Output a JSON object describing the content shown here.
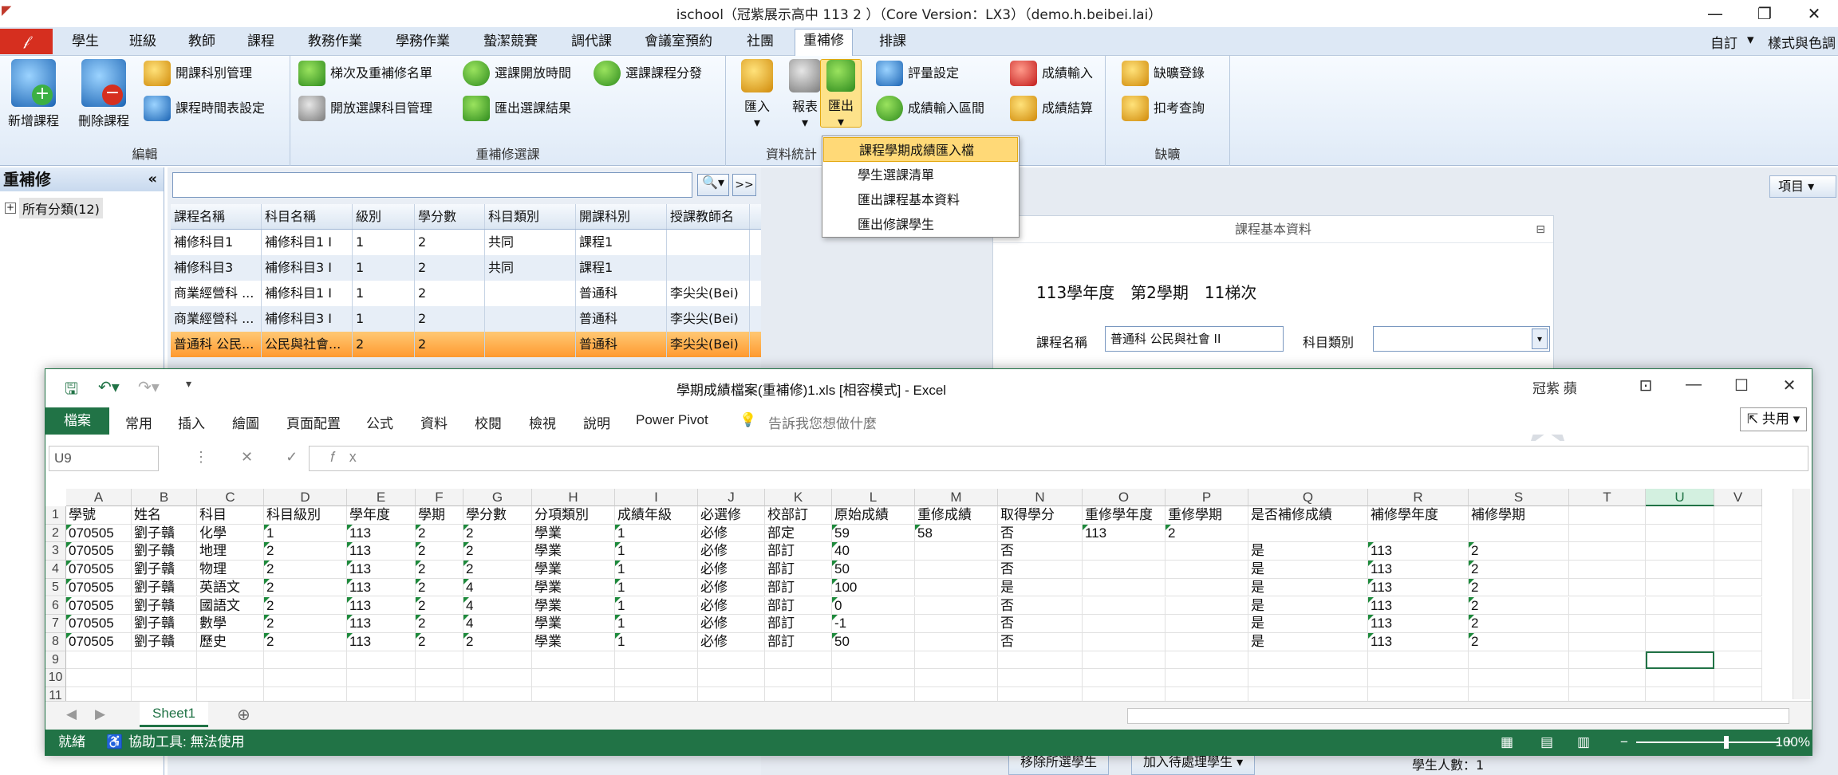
{
  "ischool": {
    "title": "ischool（冠紫展示高中 113 2 ）（Core Version：LX3）（demo.h.beibei.lai）",
    "win_controls": [
      "—",
      "❐",
      "✕"
    ],
    "tabs": [
      "學生",
      "班級",
      "教師",
      "課程",
      "教務作業",
      "學務作業",
      "蟄潔競賽",
      "調代課",
      "會議室預約",
      "社團",
      "重補修",
      "排課"
    ],
    "active_tab": "重補修",
    "right_tabs": [
      "自訂",
      "▾",
      "樣式與色調"
    ],
    "ribbon": {
      "groups": [
        "編輯",
        "重補修選課",
        "資料統計",
        "缺曠"
      ],
      "edit": {
        "add": "新增課程",
        "delete": "刪除課程",
        "subject_mgmt": "開課科別管理",
        "schedule": "課程時間表設定"
      },
      "selection": {
        "batch": "梯次及重補修名單",
        "open_time": "選課開放時間",
        "course_split": "選課課程分發",
        "open_subject": "開放選課科目管理",
        "export_result": "匯出選課結果"
      },
      "stats": {
        "import": "匯入",
        "report": "報表",
        "export": "匯出",
        "eval_setting": "評量設定",
        "score_range": "成績輸入區間",
        "score_input": "成績輸入",
        "score_calc": "成績結算"
      },
      "absence": {
        "register": "缺曠登錄",
        "deduct": "扣考查詢"
      }
    },
    "export_menu": [
      "課程學期成績匯入檔",
      "學生選課清單",
      "匯出課程基本資料",
      "匯出修課學生"
    ],
    "left_pane": {
      "title": "重補修",
      "collapse": "«",
      "tree_item": "所有分類(12)"
    },
    "search": {
      "btn": "🔍▾",
      "next": ">>"
    },
    "grid": {
      "headers": [
        "課程名稱",
        "科目名稱",
        "級別",
        "學分數",
        "科目類別",
        "開課科別",
        "授課教師名"
      ],
      "rows": [
        [
          "補修科目1",
          "補修科目1 I",
          "1",
          "2",
          "共同",
          "課程1",
          ""
        ],
        [
          "補修科目3",
          "補修科目3 I",
          "1",
          "2",
          "共同",
          "課程1",
          ""
        ],
        [
          "商業經營科 ...",
          "補修科目1 I",
          "1",
          "2",
          "",
          "普通科",
          "李尖尖(Bei)"
        ],
        [
          "商業經營科 ...",
          "補修科目3 I",
          "1",
          "2",
          "",
          "普通科",
          "李尖尖(Bei)"
        ],
        [
          "普通科 公民...",
          "公民與社會...",
          "2",
          "2",
          "",
          "普通科",
          "李尖尖(Bei)"
        ]
      ]
    },
    "right_pane": {
      "items_btn": "項目 ▾",
      "card_title": "課程基本資料",
      "card_min": "⊟",
      "year_line": "113學年度　第2學期　11梯次",
      "course_name_label": "課程名稱",
      "course_name_value": "普通科 公民與社會 II",
      "subject_type_label": "科目類別",
      "subject_type_value": ""
    },
    "bottom_buttons": [
      "移除所選學生",
      "加入待處理學生 ▾"
    ],
    "student_count": "學生人數：1"
  },
  "excel": {
    "title": "學期成績檔案(重補修)1.xls  [相容模式]  -  Excel",
    "user": "冠紫 蘋",
    "win_controls": [
      "⊡",
      "—",
      "☐",
      "✕"
    ],
    "tabs": [
      "檔案",
      "常用",
      "插入",
      "繪圖",
      "頁面配置",
      "公式",
      "資料",
      "校閱",
      "檢視",
      "說明",
      "Power Pivot"
    ],
    "tell_me": "告訴我您想做什麼",
    "share": "⇱ 共用 ▾",
    "namebox": "U9",
    "columns": [
      "A",
      "B",
      "C",
      "D",
      "E",
      "F",
      "G",
      "H",
      "I",
      "J",
      "K",
      "L",
      "M",
      "N",
      "O",
      "P",
      "Q",
      "R",
      "S",
      "T",
      "U",
      "V"
    ],
    "selected_column": "U",
    "row_numbers": [
      "1",
      "2",
      "3",
      "4",
      "5",
      "6",
      "7",
      "8",
      "9",
      "10",
      "11"
    ],
    "header_row": [
      "學號",
      "姓名",
      "科目",
      "科目級別",
      "學年度",
      "學期",
      "學分數",
      "分項類別",
      "成績年級",
      "必選修",
      "校部訂",
      "原始成績",
      "重修成績",
      "取得學分",
      "重修學年度",
      "重修學期",
      "是否補修成績",
      "補修學年度",
      "補修學期",
      "",
      ""
    ],
    "rows": [
      [
        "070505",
        "劉子贛",
        "化學",
        "1",
        "113",
        "2",
        "2",
        "學業",
        "1",
        "必修",
        "部定",
        "59",
        "58",
        "否",
        "113",
        "2",
        "",
        "",
        ""
      ],
      [
        "070505",
        "劉子贛",
        "地理",
        "2",
        "113",
        "2",
        "2",
        "學業",
        "1",
        "必修",
        "部訂",
        "40",
        "",
        "否",
        "",
        "",
        "是",
        "113",
        "2"
      ],
      [
        "070505",
        "劉子贛",
        "物理",
        "2",
        "113",
        "2",
        "2",
        "學業",
        "1",
        "必修",
        "部訂",
        "50",
        "",
        "否",
        "",
        "",
        "是",
        "113",
        "2"
      ],
      [
        "070505",
        "劉子贛",
        "英語文",
        "2",
        "113",
        "2",
        "4",
        "學業",
        "1",
        "必修",
        "部訂",
        "100",
        "",
        "是",
        "",
        "",
        "是",
        "113",
        "2"
      ],
      [
        "070505",
        "劉子贛",
        "國語文",
        "2",
        "113",
        "2",
        "4",
        "學業",
        "1",
        "必修",
        "部訂",
        "0",
        "",
        "否",
        "",
        "",
        "是",
        "113",
        "2"
      ],
      [
        "070505",
        "劉子贛",
        "數學",
        "2",
        "113",
        "2",
        "4",
        "學業",
        "1",
        "必修",
        "部訂",
        "-1",
        "",
        "否",
        "",
        "",
        "是",
        "113",
        "2"
      ],
      [
        "070505",
        "劉子贛",
        "歷史",
        "2",
        "113",
        "2",
        "2",
        "學業",
        "1",
        "必修",
        "部訂",
        "50",
        "",
        "否",
        "",
        "",
        "是",
        "113",
        "2"
      ]
    ],
    "sheet_tab": "Sheet1",
    "add_sheet": "⊕",
    "status": "就緒",
    "accessibility": "協助工具: 無法使用",
    "zoom": "100%"
  }
}
